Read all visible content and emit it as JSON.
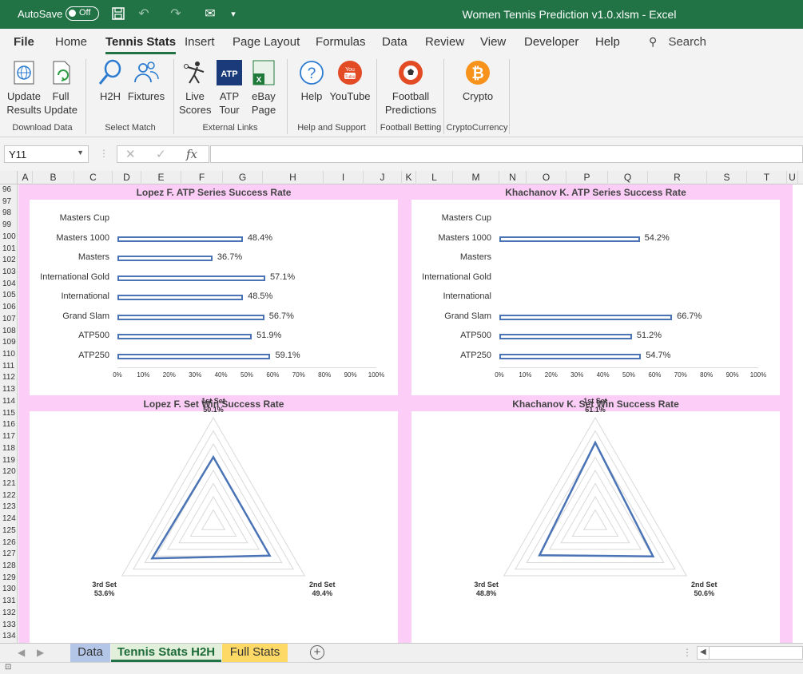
{
  "titlebar": {
    "autosave_label": "AutoSave",
    "autosave_state": "Off",
    "document_title": "Women Tennis Prediction v1.0.xlsm  -  Excel",
    "accent_color": "#217346"
  },
  "ribbon_tabs": [
    "File",
    "Home",
    "Tennis Stats",
    "Insert",
    "Page Layout",
    "Formulas",
    "Data",
    "Review",
    "View",
    "Developer",
    "Help"
  ],
  "active_tab": "Tennis Stats",
  "search_label": "Search",
  "ribbon": {
    "buttons": {
      "update_results": "Update\nResults",
      "full_update": "Full\nUpdate",
      "h2h": "H2H",
      "fixtures": "Fixtures",
      "live_scores": "Live\nScores",
      "atp_tour": "ATP\nTour",
      "ebay_page": "eBay\nPage",
      "help": "Help",
      "youtube": "YouTube",
      "football_predictions": "Football\nPredictions",
      "crypto": "Crypto"
    },
    "groups": {
      "download_data": "Download Data",
      "select_match": "Select Match",
      "external_links": "External Links",
      "help_support": "Help and Support",
      "football_betting": "Football Betting",
      "cryptocurrency": "CryptoCurrency"
    }
  },
  "formula_bar": {
    "name_box": "Y11",
    "formula": ""
  },
  "columns": [
    "A",
    "B",
    "C",
    "D",
    "E",
    "F",
    "G",
    "H",
    "I",
    "J",
    "K",
    "L",
    "M",
    "N",
    "O",
    "P",
    "Q",
    "R",
    "S",
    "T",
    "U"
  ],
  "rows": [
    "96",
    "97",
    "98",
    "99",
    "100",
    "101",
    "102",
    "103",
    "104",
    "105",
    "106",
    "107",
    "108",
    "109",
    "110",
    "111",
    "112",
    "113",
    "114",
    "115",
    "116",
    "117",
    "118",
    "119",
    "120",
    "121",
    "122",
    "123",
    "124",
    "125",
    "126",
    "127",
    "128",
    "129",
    "130",
    "131",
    "132",
    "133",
    "134"
  ],
  "charts": {
    "lopez_series": {
      "title": "Lopez F. ATP Series Success Rate",
      "type": "bar",
      "categories": [
        "Masters Cup",
        "Masters 1000",
        "Masters",
        "International Gold",
        "International",
        "Grand Slam",
        "ATP500",
        "ATP250"
      ],
      "values": [
        null,
        48.4,
        36.7,
        57.1,
        48.5,
        56.7,
        51.9,
        59.1
      ],
      "labels": [
        "",
        "48.4%",
        "36.7%",
        "57.1%",
        "48.5%",
        "56.7%",
        "51.9%",
        "59.1%"
      ],
      "x_ticks": [
        "0%",
        "10%",
        "20%",
        "30%",
        "40%",
        "50%",
        "60%",
        "70%",
        "80%",
        "90%",
        "100%"
      ]
    },
    "khachanov_series": {
      "title": "Khachanov K. ATP Series Success Rate",
      "type": "bar",
      "categories": [
        "Masters Cup",
        "Masters 1000",
        "Masters",
        "International Gold",
        "International",
        "Grand Slam",
        "ATP500",
        "ATP250"
      ],
      "values": [
        null,
        54.2,
        null,
        null,
        null,
        66.7,
        51.2,
        54.7
      ],
      "labels": [
        "",
        "54.2%",
        "",
        "",
        "",
        "66.7%",
        "51.2%",
        "54.7%"
      ],
      "x_ticks": [
        "0%",
        "10%",
        "20%",
        "30%",
        "40%",
        "50%",
        "60%",
        "70%",
        "80%",
        "90%",
        "100%"
      ]
    },
    "lopez_sets": {
      "title": "Lopez F. Set Win Success Rate",
      "type": "radar",
      "axes": [
        "1st Set",
        "2nd Set",
        "3rd Set"
      ],
      "values": [
        50.1,
        49.4,
        53.6
      ],
      "labels": [
        "50.1%",
        "49.4%",
        "53.6%"
      ]
    },
    "khachanov_sets": {
      "title": "Khachanov K. Set Win Success Rate",
      "type": "radar",
      "axes": [
        "1st Set",
        "2nd Set",
        "3rd Set"
      ],
      "values": [
        61.1,
        50.6,
        48.8
      ],
      "labels": [
        "61.1%",
        "50.6%",
        "48.8%"
      ]
    }
  },
  "chart_data": [
    {
      "type": "bar",
      "title": "Lopez F. ATP Series Success Rate",
      "categories": [
        "Masters Cup",
        "Masters 1000",
        "Masters",
        "International Gold",
        "International",
        "Grand Slam",
        "ATP500",
        "ATP250"
      ],
      "values": [
        null,
        48.4,
        36.7,
        57.1,
        48.5,
        56.7,
        51.9,
        59.1
      ],
      "xlim": [
        0,
        100
      ]
    },
    {
      "type": "bar",
      "title": "Khachanov K. ATP Series Success Rate",
      "categories": [
        "Masters Cup",
        "Masters 1000",
        "Masters",
        "International Gold",
        "International",
        "Grand Slam",
        "ATP500",
        "ATP250"
      ],
      "values": [
        null,
        54.2,
        null,
        null,
        null,
        66.7,
        51.2,
        54.7
      ],
      "xlim": [
        0,
        100
      ]
    },
    {
      "type": "radar",
      "title": "Lopez F. Set Win Success Rate",
      "categories": [
        "1st Set",
        "2nd Set",
        "3rd Set"
      ],
      "values": [
        50.1,
        49.4,
        53.6
      ]
    },
    {
      "type": "radar",
      "title": "Khachanov K. Set Win Success Rate",
      "categories": [
        "1st Set",
        "2nd Set",
        "3rd Set"
      ],
      "values": [
        61.1,
        50.6,
        48.8
      ]
    }
  ],
  "sheet_tabs": [
    {
      "label": "Data",
      "color": "#b4c6e7"
    },
    {
      "label": "Tennis Stats H2H",
      "color": "#e2efda"
    },
    {
      "label": "Full Stats",
      "color": "#ffd966"
    }
  ],
  "active_sheet": "Tennis Stats H2H"
}
